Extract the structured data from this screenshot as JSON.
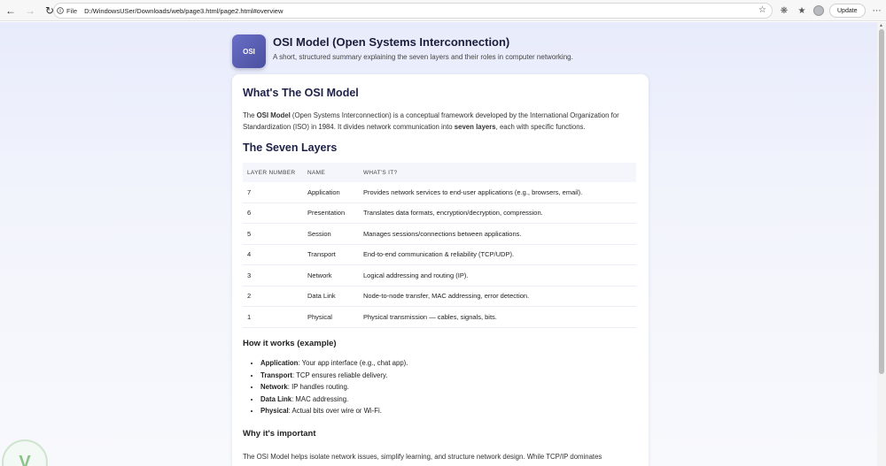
{
  "browser": {
    "address_label": "File",
    "url": "D:/WindowsUSer/Downloads/web/page3.html/page2.html#overview",
    "update_label": "Update"
  },
  "header": {
    "logo_text": "OSI",
    "title": "OSI Model (Open Systems Interconnection)",
    "subtitle": "A short, structured summary explaining the seven layers and their roles in computer networking."
  },
  "overview": {
    "heading": "What's The OSI Model",
    "p_pre": "The ",
    "p_bold1": "OSI Model",
    "p_mid": " (Open Systems Interconnection) is a conceptual framework developed by the International Organization for Standardization (ISO) in 1984. It divides network communication into ",
    "p_bold2": "seven layers",
    "p_post": ", each with specific functions."
  },
  "layers": {
    "heading": "The Seven Layers",
    "columns": [
      "LAYER NUMBER",
      "NAME",
      "WHAT'S IT?"
    ],
    "rows": [
      {
        "num": "7",
        "name": "Application",
        "desc": "Provides network services to end-user applications (e.g., browsers, email)."
      },
      {
        "num": "6",
        "name": "Presentation",
        "desc": "Translates data formats, encryption/decryption, compression."
      },
      {
        "num": "5",
        "name": "Session",
        "desc": "Manages sessions/connections between applications."
      },
      {
        "num": "4",
        "name": "Transport",
        "desc": "End-to-end communication & reliability (TCP/UDP)."
      },
      {
        "num": "3",
        "name": "Network",
        "desc": "Logical addressing and routing (IP)."
      },
      {
        "num": "2",
        "name": "Data Link",
        "desc": "Node-to-node transfer, MAC addressing, error detection."
      },
      {
        "num": "1",
        "name": "Physical",
        "desc": "Physical transmission — cables, signals, bits."
      }
    ]
  },
  "how": {
    "heading": "How it works (example)",
    "items": [
      {
        "term": "Application",
        "text": ": Your app interface (e.g., chat app)."
      },
      {
        "term": "Transport",
        "text": ": TCP ensures reliable delivery."
      },
      {
        "term": "Network",
        "text": ": IP handles routing."
      },
      {
        "term": "Data Link",
        "text": ": MAC addressing."
      },
      {
        "term": "Physical",
        "text": ": Actual bits over wire or Wi-Fi."
      }
    ]
  },
  "why": {
    "heading": "Why it's important",
    "text": "The OSI Model helps isolate network issues, simplify learning, and structure network design. While TCP/IP dominates"
  }
}
